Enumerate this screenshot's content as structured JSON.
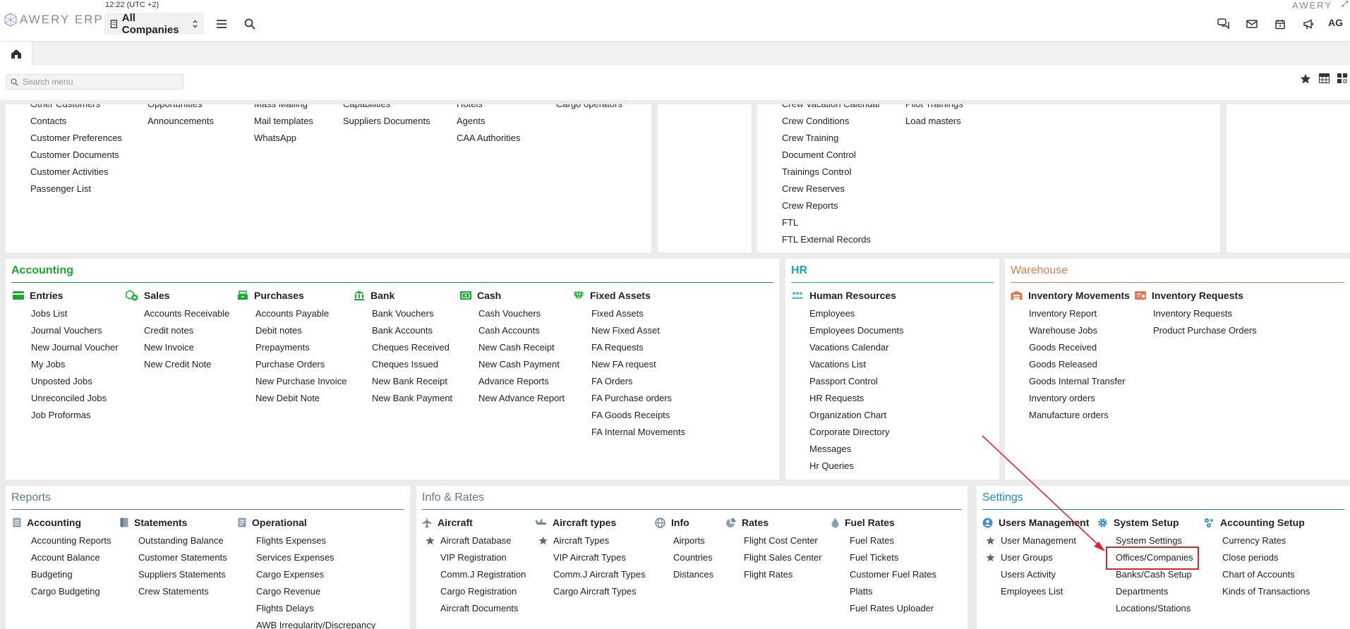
{
  "topbar": {
    "logo_text": "AWERY ERP",
    "time": "12:22 (UTC +2)",
    "company": "All Companies",
    "brand_right": "AWERY",
    "user_initials": "AG"
  },
  "search": {
    "placeholder": "Search menu"
  },
  "top_columns": [
    [
      "Other Customers",
      "Contacts",
      "Customer Preferences",
      "Customer Documents",
      "Customer Activities",
      "Passenger List"
    ],
    [
      "Opportunities",
      "Announcements"
    ],
    [
      "Mass Mailing",
      "Mail templates",
      "WhatsApp"
    ],
    [
      "Capabilities",
      "Suppliers Documents"
    ],
    [
      "Hotels",
      "Agents",
      "CAA Authorities"
    ],
    [
      "Cargo operators"
    ],
    [
      "Crew Vacation Calendar",
      "Crew Conditions",
      "Crew Training",
      "Document Control",
      "Trainings Control",
      "Crew Reserves",
      "Crew Reports",
      "FTL",
      "FTL External Records"
    ],
    [
      "Pilot Trainings",
      "Load masters"
    ]
  ],
  "accounting": {
    "title": "Accounting",
    "color": "#19a82c",
    "groups": [
      {
        "label": "Entries",
        "items": [
          "Jobs List",
          "Journal Vouchers",
          "New Journal Voucher",
          "My Jobs",
          "Unposted Jobs",
          "Unreconciled Jobs",
          "Job Proformas"
        ]
      },
      {
        "label": "Sales",
        "items": [
          "Accounts Receivable",
          "Credit notes",
          "New Invoice",
          "New Credit Note"
        ]
      },
      {
        "label": "Purchases",
        "items": [
          "Accounts Payable",
          "Debit notes",
          "Prepayments",
          "Purchase Orders",
          "New Purchase Invoice",
          "New Debit Note"
        ]
      },
      {
        "label": "Bank",
        "items": [
          "Bank Vouchers",
          "Bank Accounts",
          "Cheques Received",
          "Cheques Issued",
          "New Bank Receipt",
          "New Bank Payment"
        ]
      },
      {
        "label": "Cash",
        "items": [
          "Cash Vouchers",
          "Cash Accounts",
          "New Cash Receipt",
          "New Cash Payment",
          "Advance Reports",
          "New Advance Report"
        ]
      },
      {
        "label": "Fixed Assets",
        "items": [
          "Fixed Assets",
          "New Fixed Asset",
          "FA Requests",
          "New FA request",
          "FA Orders",
          "FA Purchase orders",
          "FA Goods Receipts",
          "FA Internal Movements"
        ]
      }
    ]
  },
  "hr": {
    "title": "HR",
    "color": "#1aa8a0",
    "groups": [
      {
        "label": "Human Resources",
        "items": [
          "Employees",
          "Employees Documents",
          "Vacations Calendar",
          "Vacations List",
          "Passport Control",
          "HR Requests",
          "Organization Chart",
          "Corporate Directory",
          "Messages",
          "Hr Queries"
        ]
      }
    ]
  },
  "warehouse": {
    "title": "Warehouse",
    "color": "#e07a50",
    "groups": [
      {
        "label": "Inventory Movements",
        "items": [
          "Inventory Report",
          "Warehouse Jobs",
          "Goods Received",
          "Goods Released",
          "Goods Internal Transfer",
          "Inventory orders",
          "Manufacture orders"
        ]
      },
      {
        "label": "Inventory Requests",
        "items": [
          "Inventory Requests",
          "Product Purchase Orders"
        ]
      }
    ]
  },
  "reports": {
    "title": "Reports",
    "color": "#5d7a8c",
    "groups": [
      {
        "label": "Accounting",
        "items": [
          "Accounting Reports",
          "Account Balance",
          "Budgeting",
          "Cargo Budgeting"
        ]
      },
      {
        "label": "Statements",
        "items": [
          "Outstanding Balance",
          "Customer Statements",
          "Suppliers Statements",
          "Crew Statements"
        ]
      },
      {
        "label": "Operational",
        "items": [
          "Flights Expenses",
          "Services Expenses",
          "Cargo Expenses",
          "Cargo Revenue",
          "Flights Delays",
          "AWB Irregularity/Discrepancy"
        ]
      }
    ]
  },
  "info_rates": {
    "title": "Info & Rates",
    "color": "#5d7a8c",
    "groups": [
      {
        "label": "Aircraft",
        "items": [
          "Aircraft Database",
          "VIP Registration",
          "Comm.J Registration",
          "Cargo Registration",
          "Aircraft Documents"
        ]
      },
      {
        "label": "Aircraft types",
        "items": [
          "Aircraft Types",
          "VIP Aircraft Types",
          "Comm.J Aircraft Types",
          "Cargo Aircraft Types"
        ]
      },
      {
        "label": "Info",
        "items": [
          "Airports",
          "Countries",
          "Distances"
        ]
      },
      {
        "label": "Rates",
        "items": [
          "Flight Cost Center",
          "Flight Sales Center",
          "Flight Rates"
        ]
      },
      {
        "label": "Fuel Rates",
        "items": [
          "Fuel Rates",
          "Fuel Tickets",
          "Customer Fuel Rates",
          "Platts",
          "Fuel Rates Uploader"
        ]
      }
    ]
  },
  "settings": {
    "title": "Settings",
    "color": "#1e88c8",
    "groups": [
      {
        "label": "Users Management",
        "items": [
          "User Management",
          "User Groups",
          "Users Activity",
          "Employees List"
        ]
      },
      {
        "label": "System Setup",
        "items": [
          "System Settings",
          "Offices/Companies",
          "Banks/Cash Setup",
          "Departments",
          "Locations/Stations"
        ]
      },
      {
        "label": "Accounting Setup",
        "items": [
          "Currency Rates",
          "Close periods",
          "Chart of Accounts",
          "Kinds of Transactions"
        ]
      }
    ]
  }
}
